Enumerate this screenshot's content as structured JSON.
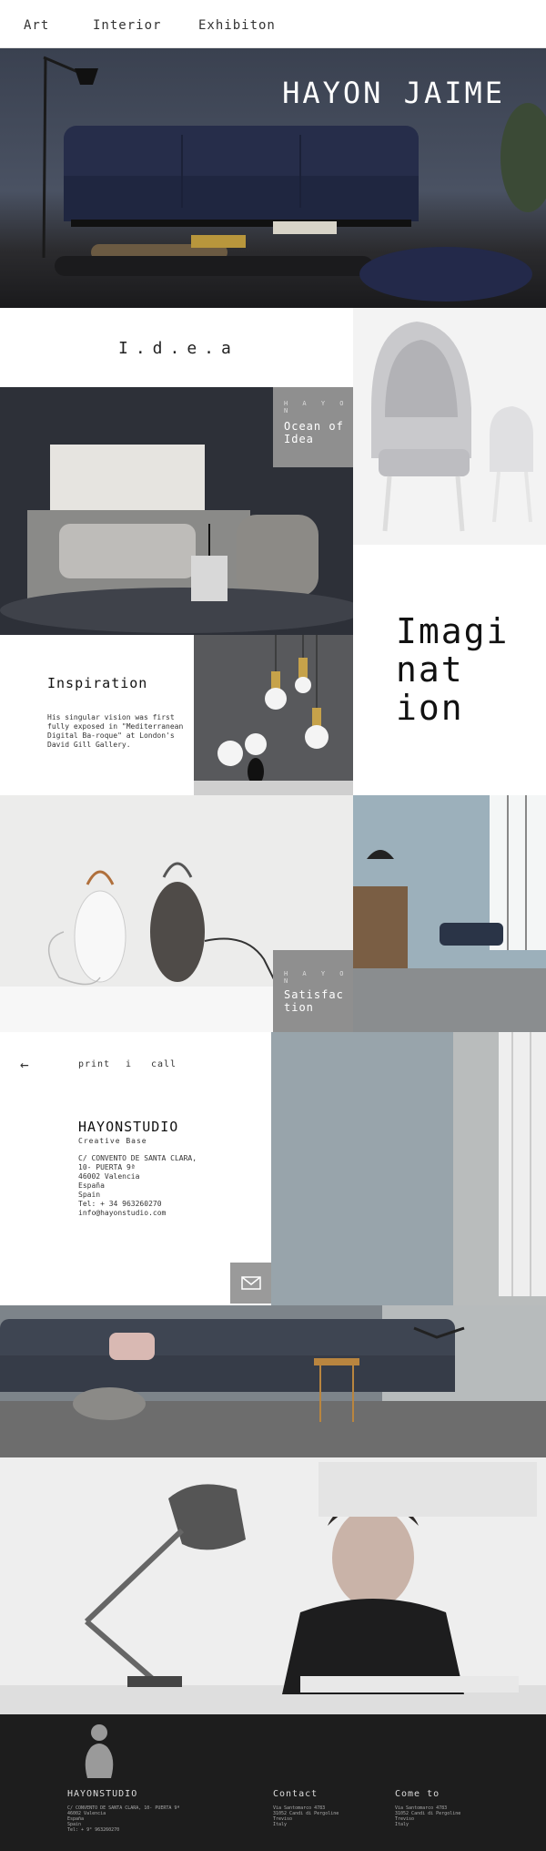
{
  "nav": {
    "items": [
      "Art",
      "Interior",
      "Exhibiton"
    ]
  },
  "hero": {
    "title": "HAYON JAIME"
  },
  "idea": {
    "title": "I.d.e.a"
  },
  "ocean": {
    "small": "H A Y O N",
    "line1": "Ocean of",
    "line2": "Idea"
  },
  "imagination": {
    "line1": "Imagi",
    "line2": "nat",
    "line3": "ion"
  },
  "inspiration": {
    "title": "Inspiration",
    "body": "His singular vision was first fully exposed in \"Mediterranean Digital Ba-roque\" at London's David Gill Gallery."
  },
  "satisfaction": {
    "small": "H A Y O N",
    "line1": "Satisfac",
    "line2": "tion"
  },
  "contact_bar": {
    "back": "←",
    "print": "print",
    "sep": "i",
    "call": "call"
  },
  "studio": {
    "title": "HAYONSTUDIO",
    "subtitle": "Creative Base",
    "address": [
      "C/ CONVENTO DE SANTA CLARA,",
      "10- PUERTA 9ª",
      "46002 Valencia",
      "España",
      "Spain",
      "Tel: + 34 963260270",
      "info@hayonstudio.com"
    ]
  },
  "footer": {
    "col1": {
      "title": "HAYONSTUDIO",
      "lines": [
        "C/ CONVENTO DE SANTA CLARA, 10- PUERTA 9ª",
        "46002 Valencia",
        "España",
        "Spain",
        "Tel: + 9° 963260270"
      ]
    },
    "col2": {
      "title": "Contact",
      "lines": [
        "Via Santomarco 4783",
        "31052 Candi di Pergoline",
        "Treviso",
        "Italy"
      ]
    },
    "col3": {
      "title": "Come to",
      "lines": [
        "Via Santomarco 4783",
        "31052 Candi di Pergoline",
        "Treviso",
        "Italy"
      ]
    }
  },
  "colors": {
    "overlay": "#8f8f8f",
    "footer": "#1d1d1d",
    "sofa_navy": "#262d4a"
  },
  "icons": [
    "back-arrow-icon",
    "mail-icon",
    "logo-figure-icon"
  ]
}
